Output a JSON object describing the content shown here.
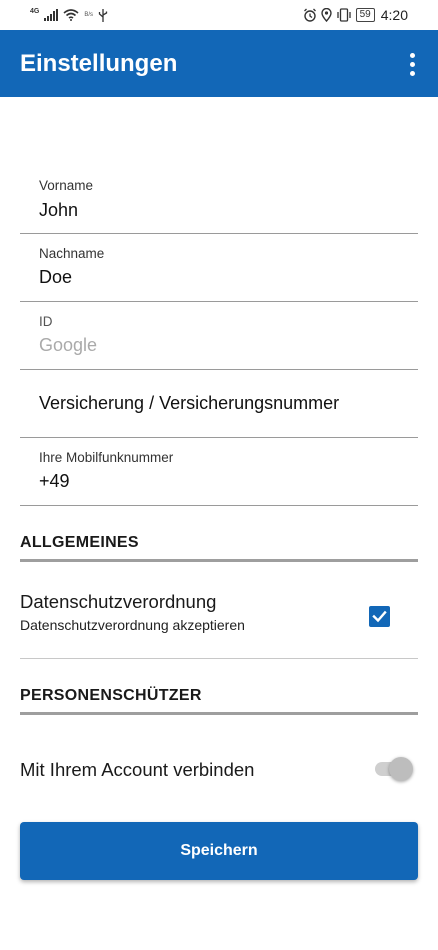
{
  "status_bar": {
    "network": "4G",
    "data_speed": "B/s",
    "battery": "59",
    "time": "4:20",
    "icons": [
      "signal-icon",
      "wifi-icon",
      "usb-icon",
      "alarm-icon",
      "location-icon",
      "vibrate-icon",
      "battery-icon"
    ]
  },
  "app_bar": {
    "title": "Einstellungen",
    "menu_icon": "more-vert-icon"
  },
  "fields": {
    "first_name": {
      "label": "Vorname",
      "value": "John"
    },
    "last_name": {
      "label": "Nachname",
      "value": "Doe"
    },
    "id": {
      "label": "ID",
      "placeholder": "Google"
    },
    "insurance": {
      "value": "Versicherung / Versicherungsnummer"
    },
    "mobile": {
      "label": "Ihre Mobilfunknummer",
      "value": "+49"
    }
  },
  "general": {
    "section_title": "ALLGEMEINES",
    "privacy": {
      "title": "Datenschutzverordnung",
      "subtitle": "Datenschutzverordnung akzeptieren",
      "checked": true
    }
  },
  "protector": {
    "section_title": "PERSONENSCHÜTZER",
    "connect": {
      "title": "Mit Ihrem Account verbinden",
      "enabled": false
    }
  },
  "save_button": {
    "label": "Speichern"
  },
  "colors": {
    "primary": "#1267b7",
    "background": "#ffffff",
    "divider": "#9e9e9e"
  }
}
